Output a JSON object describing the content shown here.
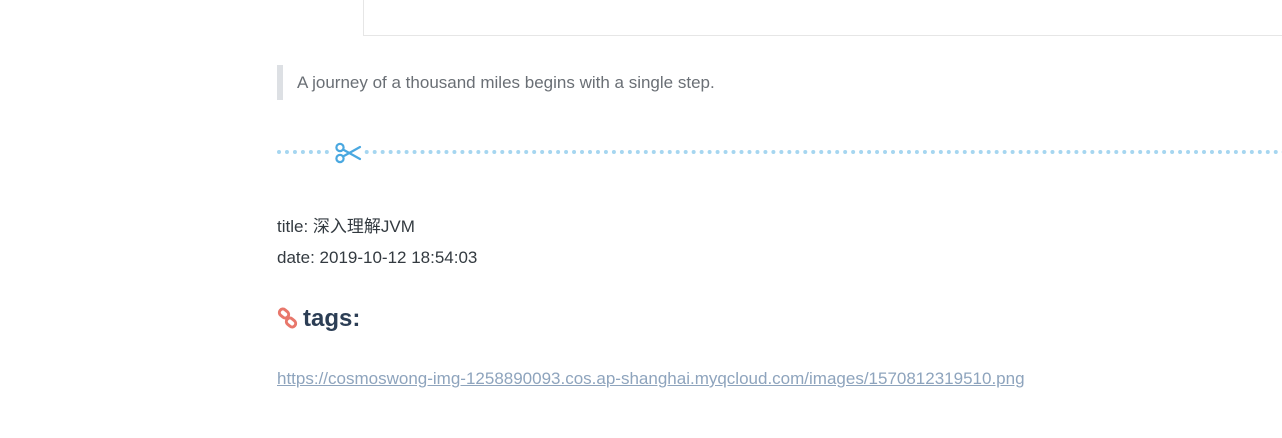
{
  "quote": {
    "text": "A journey of a thousand miles begins with a single step."
  },
  "meta": {
    "title_line": "title: 深入理解JVM",
    "date_line": "date: 2019-10-12 18:54:03"
  },
  "tags": {
    "heading": "tags:",
    "icon": "link-icon"
  },
  "image_link": {
    "text": "https://cosmoswong-img-1258890093.cos.ap-shanghai.myqcloud.com/images/1570812319510.png"
  },
  "colors": {
    "divider": "#a6d6f0",
    "scissors": "#4aa8e0",
    "link_icon": "#e8776b",
    "heading": "#2c3e55",
    "link": "#8ea4bd"
  }
}
